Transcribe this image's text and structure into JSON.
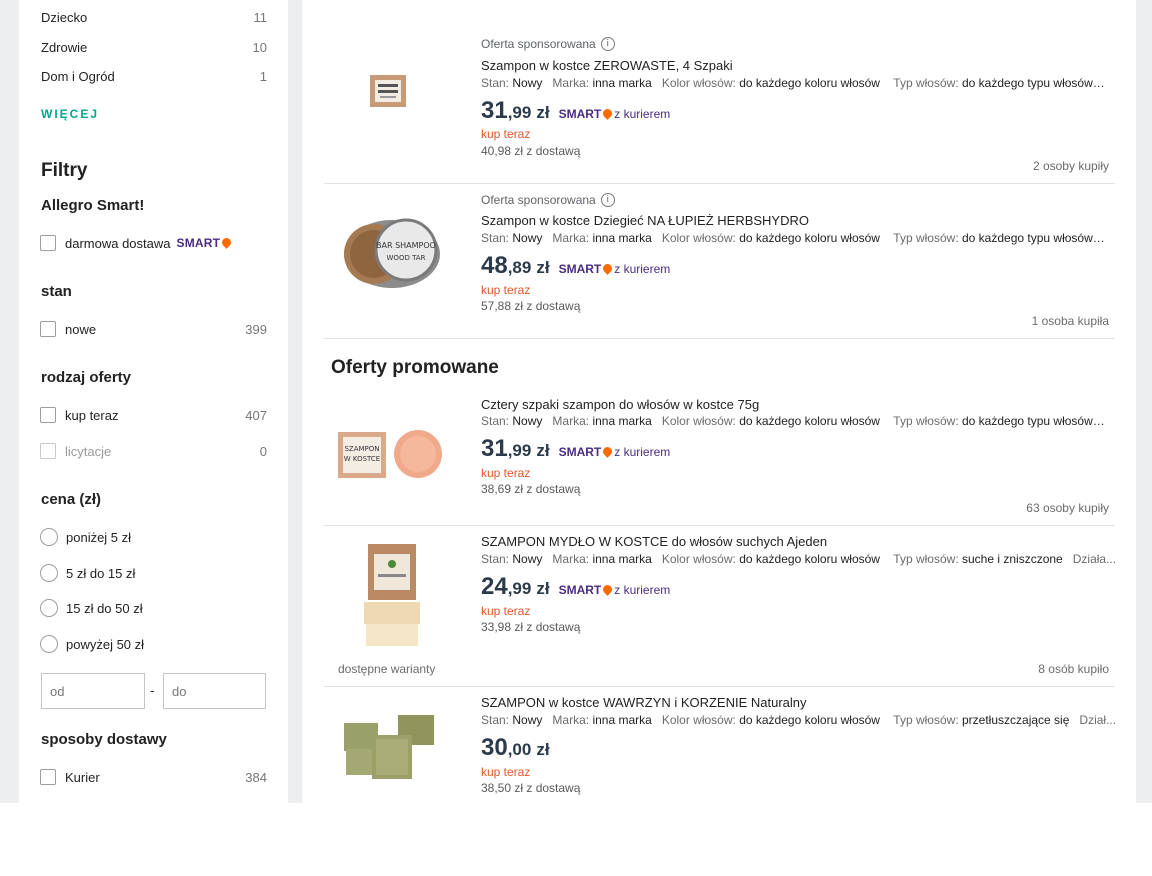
{
  "categories": [
    {
      "label": "Dziecko",
      "count": "11"
    },
    {
      "label": "Zdrowie",
      "count": "10"
    },
    {
      "label": "Dom i Ogród",
      "count": "1"
    }
  ],
  "more_label": "WIĘCEJ",
  "filters_heading": "Filtry",
  "allegro_smart": {
    "heading": "Allegro Smart!",
    "option_label": "darmowa dostawa",
    "badge": "SMART"
  },
  "stan": {
    "heading": "stan",
    "options": [
      {
        "label": "nowe",
        "count": "399"
      }
    ]
  },
  "rodzaj": {
    "heading": "rodzaj oferty",
    "options": [
      {
        "label": "kup teraz",
        "count": "407"
      },
      {
        "label": "licytacje",
        "count": "0"
      }
    ]
  },
  "cena": {
    "heading": "cena (zł)",
    "options": [
      "poniżej 5 zł",
      "5 zł do 15 zł",
      "15 zł do 50 zł",
      "powyżej 50 zł"
    ],
    "from_placeholder": "od",
    "to_placeholder": "do",
    "dash": "-"
  },
  "dostawa": {
    "heading": "sposoby dostawy",
    "options": [
      {
        "label": "Kurier",
        "count": "384"
      }
    ]
  },
  "promoted_heading": "Oferty promowane",
  "param_keys": {
    "stan": "Stan:",
    "marka": "Marka:",
    "kolor": "Kolor włosów:",
    "typ": "Typ włosów:"
  },
  "smart_label": "SMART",
  "courier_label": "z kurierem",
  "buy_now": "kup teraz",
  "offers": [
    {
      "sponsored": "Oferta sponsorowana",
      "title": "Szampon w kostce ZEROWASTE, 4 Szpaki",
      "stan": "Nowy",
      "marka": "inna marka",
      "kolor": "do każdego koloru włosów",
      "typ": "do każdego typu włosów",
      "extra": "",
      "price_int": "31",
      "price_frac": ",99",
      "currency": "zł",
      "delivery": "40,98 zł z dostawą",
      "bought": "2 osoby kupiły"
    },
    {
      "sponsored": "Oferta sponsorowana",
      "title": "Szampon w kostce Dziegieć NA ŁUPIEŻ HERBSHYDRO",
      "stan": "Nowy",
      "marka": "inna marka",
      "kolor": "do każdego koloru włosów",
      "typ": "do każdego typu włosów",
      "extra": "",
      "price_int": "48",
      "price_frac": ",89",
      "currency": "zł",
      "delivery": "57,88 zł z dostawą",
      "bought": "1 osoba kupiła"
    },
    {
      "title": "Cztery szpaki szampon do włosów w kostce 75g",
      "stan": "Nowy",
      "marka": "inna marka",
      "kolor": "do każdego koloru włosów",
      "typ": "do każdego typu włosów",
      "extra": "",
      "price_int": "31",
      "price_frac": ",99",
      "currency": "zł",
      "delivery": "38,69 zł z dostawą",
      "bought": "63 osoby kupiły"
    },
    {
      "title": "SZAMPON MYDŁO W KOSTCE do włosów suchych Ajeden",
      "stan": "Nowy",
      "marka": "inna marka",
      "kolor": "do każdego koloru włosów",
      "typ": "suche i zniszczone",
      "extra": "Działa...",
      "price_int": "24",
      "price_frac": ",99",
      "currency": "zł",
      "delivery": "33,98 zł z dostawą",
      "bought": "8 osób kupiło",
      "variants": "dostępne warianty"
    },
    {
      "title": "SZAMPON w kostce WAWRZYN i KORZENIE Naturalny",
      "stan": "Nowy",
      "marka": "inna marka",
      "kolor": "do każdego koloru włosów",
      "typ": "przetłuszczające się",
      "extra": "Dział...",
      "price_int": "30",
      "price_frac": ",00",
      "currency": "zł",
      "delivery": "38,50 zł z dostawą"
    }
  ],
  "colors": {
    "accent": "#00a790",
    "smart": "#4a2c82",
    "smart_pin": "#ff6a00",
    "buy_now": "#e0572b",
    "page_bg": "#eceeef"
  }
}
